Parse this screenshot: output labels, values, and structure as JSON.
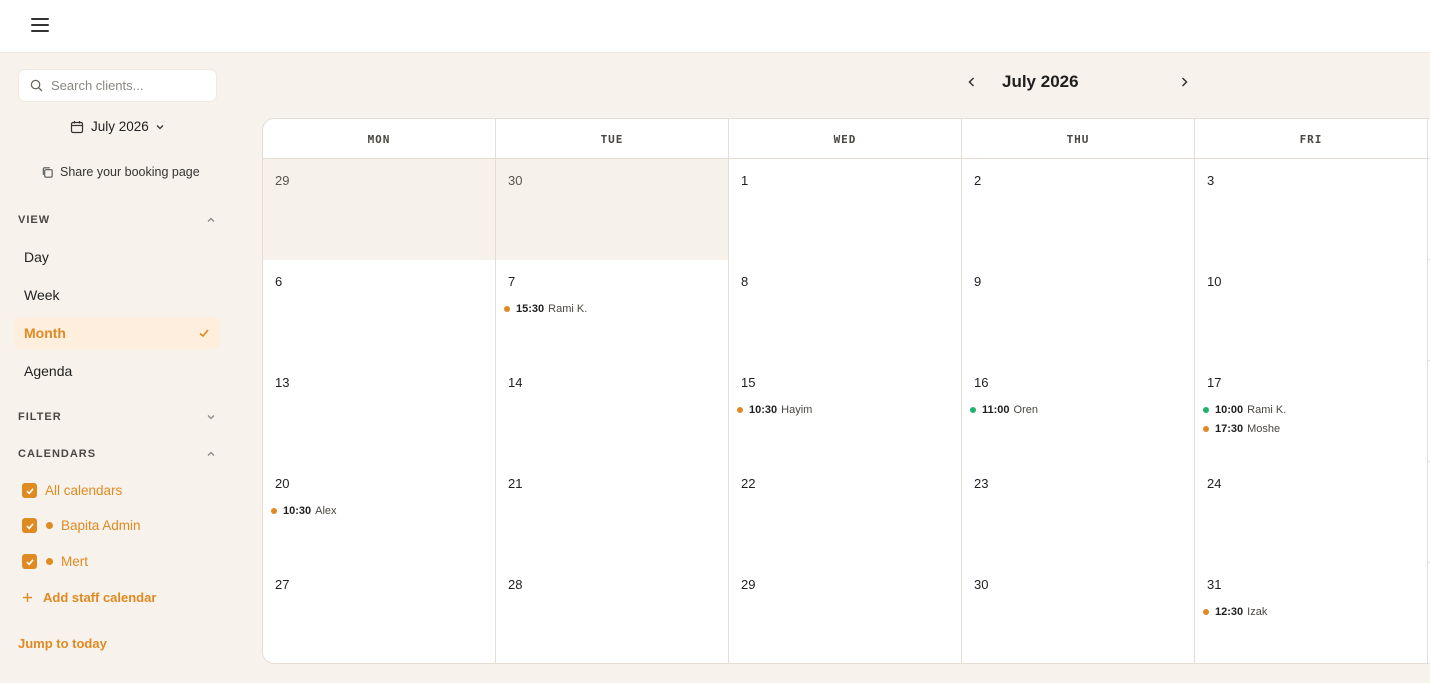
{
  "colors": {
    "accent": "#e08a22",
    "green": "#1eb36a",
    "other_month_bg": "#f6f1ea"
  },
  "sidebar": {
    "search_placeholder": "Search clients...",
    "month_picker": "July 2026",
    "share_label": "Share your booking page",
    "view_heading": "VIEW",
    "views": [
      {
        "label": "Day",
        "active": false
      },
      {
        "label": "Week",
        "active": false
      },
      {
        "label": "Month",
        "active": true
      },
      {
        "label": "Agenda",
        "active": false
      }
    ],
    "filter_heading": "FILTER",
    "calendars_heading": "CALENDARS",
    "calendars": [
      {
        "label": "All calendars",
        "checked": true,
        "dot": false
      },
      {
        "label": "Bapita Admin",
        "checked": true,
        "dot": true
      },
      {
        "label": "Mert",
        "checked": true,
        "dot": true
      }
    ],
    "add_staff_label": "Add staff calendar",
    "jump_today_label": "Jump to today"
  },
  "calendar": {
    "title": "July 2026",
    "days_of_week": [
      "MON",
      "TUE",
      "WED",
      "THU",
      "FRI"
    ],
    "weeks": [
      [
        {
          "day": "29",
          "other_month": true,
          "events": []
        },
        {
          "day": "30",
          "other_month": true,
          "events": []
        },
        {
          "day": "1",
          "other_month": false,
          "events": []
        },
        {
          "day": "2",
          "other_month": false,
          "events": []
        },
        {
          "day": "3",
          "other_month": false,
          "events": []
        }
      ],
      [
        {
          "day": "6",
          "other_month": false,
          "events": []
        },
        {
          "day": "7",
          "other_month": false,
          "events": [
            {
              "time": "15:30",
              "name": "Rami K.",
              "color": "#e08a22"
            }
          ]
        },
        {
          "day": "8",
          "other_month": false,
          "events": []
        },
        {
          "day": "9",
          "other_month": false,
          "events": []
        },
        {
          "day": "10",
          "other_month": false,
          "events": []
        }
      ],
      [
        {
          "day": "13",
          "other_month": false,
          "events": []
        },
        {
          "day": "14",
          "other_month": false,
          "events": []
        },
        {
          "day": "15",
          "other_month": false,
          "events": [
            {
              "time": "10:30",
              "name": "Hayim",
              "color": "#e08a22"
            }
          ]
        },
        {
          "day": "16",
          "other_month": false,
          "events": [
            {
              "time": "11:00",
              "name": "Oren",
              "color": "#1eb36a"
            }
          ]
        },
        {
          "day": "17",
          "other_month": false,
          "events": [
            {
              "time": "10:00",
              "name": "Rami K.",
              "color": "#1eb36a"
            },
            {
              "time": "17:30",
              "name": "Moshe",
              "color": "#e08a22"
            }
          ]
        }
      ],
      [
        {
          "day": "20",
          "other_month": false,
          "events": [
            {
              "time": "10:30",
              "name": "Alex",
              "color": "#e08a22"
            }
          ]
        },
        {
          "day": "21",
          "other_month": false,
          "events": []
        },
        {
          "day": "22",
          "other_month": false,
          "events": []
        },
        {
          "day": "23",
          "other_month": false,
          "events": []
        },
        {
          "day": "24",
          "other_month": false,
          "events": []
        }
      ],
      [
        {
          "day": "27",
          "other_month": false,
          "events": []
        },
        {
          "day": "28",
          "other_month": false,
          "events": []
        },
        {
          "day": "29",
          "other_month": false,
          "events": []
        },
        {
          "day": "30",
          "other_month": false,
          "events": []
        },
        {
          "day": "31",
          "other_month": false,
          "events": [
            {
              "time": "12:30",
              "name": "Izak",
              "color": "#e08a22"
            }
          ]
        }
      ]
    ]
  }
}
